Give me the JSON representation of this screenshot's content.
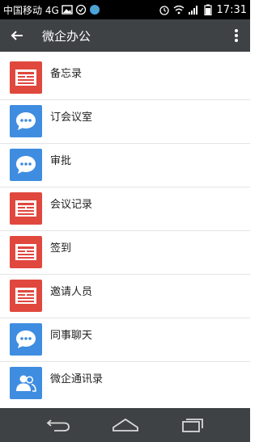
{
  "status_bar": {
    "carrier": "中国移动 4G",
    "time": "17:31"
  },
  "app_bar": {
    "title": "微企办公"
  },
  "items": [
    {
      "label": "备忘录",
      "icon": "document-icon",
      "color": "#e0483e"
    },
    {
      "label": "订会议室",
      "icon": "chat-bubble-icon",
      "color": "#3f8de0"
    },
    {
      "label": "审批",
      "icon": "chat-bubble-icon",
      "color": "#3f8de0"
    },
    {
      "label": "会议记录",
      "icon": "document-icon",
      "color": "#e0483e"
    },
    {
      "label": "签到",
      "icon": "document-icon",
      "color": "#e0483e"
    },
    {
      "label": "邀请人员",
      "icon": "document-icon",
      "color": "#e0483e"
    },
    {
      "label": "同事聊天",
      "icon": "chat-bubble-icon",
      "color": "#3f8de0"
    },
    {
      "label": "微企通讯录",
      "icon": "contacts-icon",
      "color": "#3f8de0"
    }
  ]
}
